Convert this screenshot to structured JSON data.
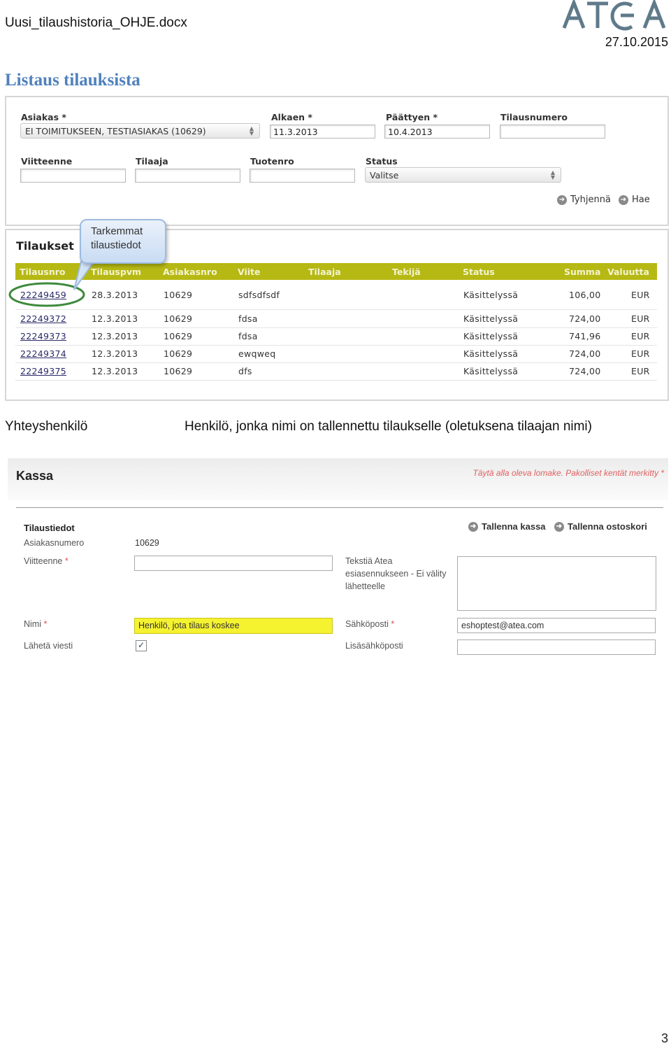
{
  "header": {
    "filename": "Uusi_tilaushistoria_OHJE.docx",
    "date": "27.10.2015",
    "logo_text": "ATEA"
  },
  "section_title": "Listaus tilauksista",
  "search_form": {
    "asiakas_label": "Asiakas *",
    "asiakas_value": "EI TOIMITUKSEEN, TESTIASIAKAS (10629)",
    "alkaen_label": "Alkaen *",
    "alkaen_value": "11.3.2013",
    "paattyen_label": "Päättyen *",
    "paattyen_value": "10.4.2013",
    "tilausnumero_label": "Tilausnumero",
    "viitteenne_label": "Viitteenne",
    "tilaaja_label": "Tilaaja",
    "tuotenro_label": "Tuotenro",
    "status_label": "Status",
    "status_value": "Valitse",
    "clear_button": "Tyhjennä",
    "search_button": "Hae"
  },
  "orders": {
    "title": "Tilaukset",
    "callout_line1": "Tarkemmat",
    "callout_line2": "tilaustiedot",
    "columns": [
      "Tilausnro",
      "Tilauspvm",
      "Asiakasnro",
      "Viite",
      "Tilaaja",
      "Tekijä",
      "Status",
      "Summa",
      "Valuutta"
    ],
    "rows": [
      {
        "nro": "22249459",
        "pvm": "28.3.2013",
        "asiakas": "10629",
        "viite": "sdfsdfsdf",
        "status": "Käsittelyssä",
        "summa": "106,00",
        "valuutta": "EUR"
      },
      {
        "nro": "22249372",
        "pvm": "12.3.2013",
        "asiakas": "10629",
        "viite": "fdsa",
        "status": "Käsittelyssä",
        "summa": "724,00",
        "valuutta": "EUR"
      },
      {
        "nro": "22249373",
        "pvm": "12.3.2013",
        "asiakas": "10629",
        "viite": "fdsa",
        "status": "Käsittelyssä",
        "summa": "741,96",
        "valuutta": "EUR"
      },
      {
        "nro": "22249374",
        "pvm": "12.3.2013",
        "asiakas": "10629",
        "viite": "ewqweq",
        "status": "Käsittelyssä",
        "summa": "724,00",
        "valuutta": "EUR"
      },
      {
        "nro": "22249375",
        "pvm": "12.3.2013",
        "asiakas": "10629",
        "viite": "dfs",
        "status": "Käsittelyssä",
        "summa": "724,00",
        "valuutta": "EUR"
      }
    ]
  },
  "definition": {
    "term": "Yhteyshenkilö",
    "text": "Henkilö, jonka nimi on tallennettu tilaukselle (oletuksena tilaajan nimi)"
  },
  "kassa": {
    "title": "Kassa",
    "hint": "Täytä alla oleva lomake. Pakolliset kentät merkitty *",
    "section_label": "Tilaustiedot",
    "save_kassa": "Tallenna kassa",
    "save_cart": "Tallenna ostoskori",
    "asiakasnumero_label": "Asiakasnumero",
    "asiakasnumero_value": "10629",
    "viitteenne_label": "Viitteenne",
    "teksti_label_1": "Tekstiä Atea",
    "teksti_label_2": "esiasennukseen - Ei välity",
    "teksti_label_3": "lähetteelle",
    "nimi_label": "Nimi",
    "nimi_value": "Henkilö, jota tilaus koskee",
    "sahkoposti_label": "Sähköposti",
    "sahkoposti_value": "eshoptest@atea.com",
    "laheta_label": "Lähetä viesti",
    "lisasahkoposti_label": "Lisäsähköposti",
    "required_mark": "*"
  },
  "page_number": "3",
  "colors": {
    "heading": "#4f81bd",
    "table_header": "#b6b814",
    "highlight_field": "#f5f230",
    "circle_highlight": "#3d8a3d"
  }
}
